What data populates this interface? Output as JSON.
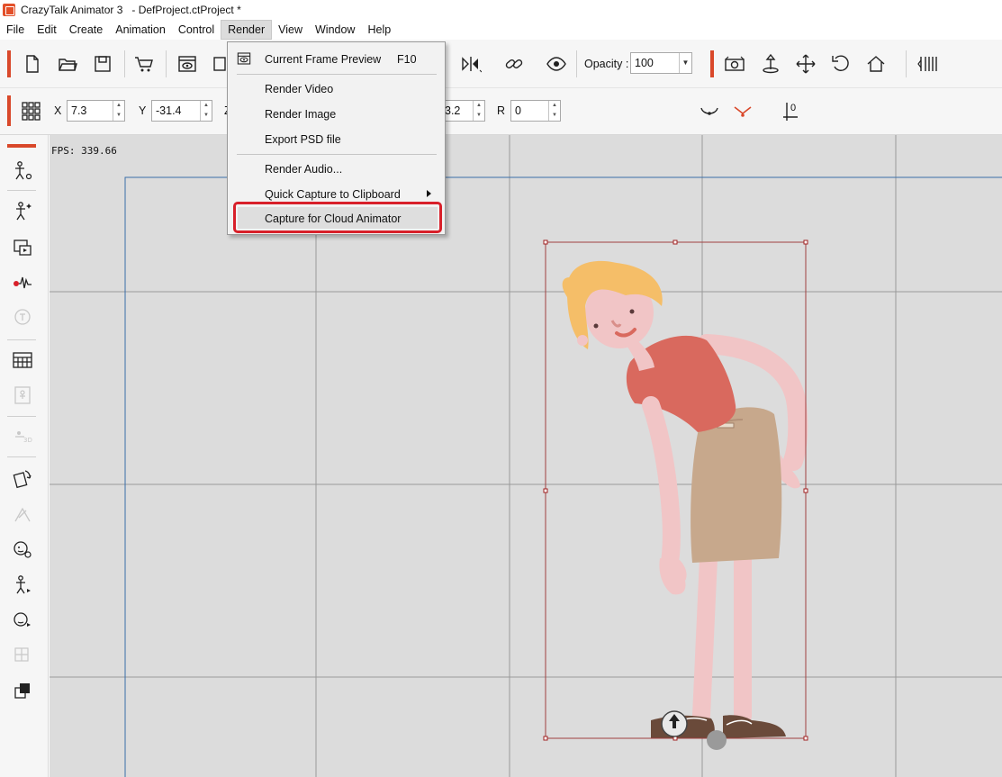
{
  "window": {
    "title": "CrazyTalk Animator 3   - DefProject.ctProject *"
  },
  "menubar": {
    "items": [
      "File",
      "Edit",
      "Create",
      "Animation",
      "Control",
      "Render",
      "View",
      "Window",
      "Help"
    ],
    "active": "Render"
  },
  "toolbar": {
    "opacity_label": "Opacity :",
    "opacity_value": "100"
  },
  "transform": {
    "x_label": "X",
    "x_value": "7.3",
    "y_label": "Y",
    "y_value": "-31.4",
    "z_label": "Z",
    "partial_value": "3.2",
    "r_label": "R",
    "r_value": "0",
    "pivot_value": "0"
  },
  "render_menu": {
    "current_frame_preview": "Current Frame Preview",
    "current_frame_shortcut": "F10",
    "render_video": "Render Video",
    "render_image": "Render Image",
    "export_psd": "Export PSD file",
    "render_audio": "Render Audio...",
    "quick_capture": "Quick Capture to Clipboard",
    "capture_cloud": "Capture for Cloud Animator"
  },
  "stage": {
    "fps_text": "FPS: 339.66"
  },
  "colors": {
    "accent": "#d9482a",
    "highlight_box": "#d8202a",
    "stage_bg": "#dcdcdc"
  }
}
